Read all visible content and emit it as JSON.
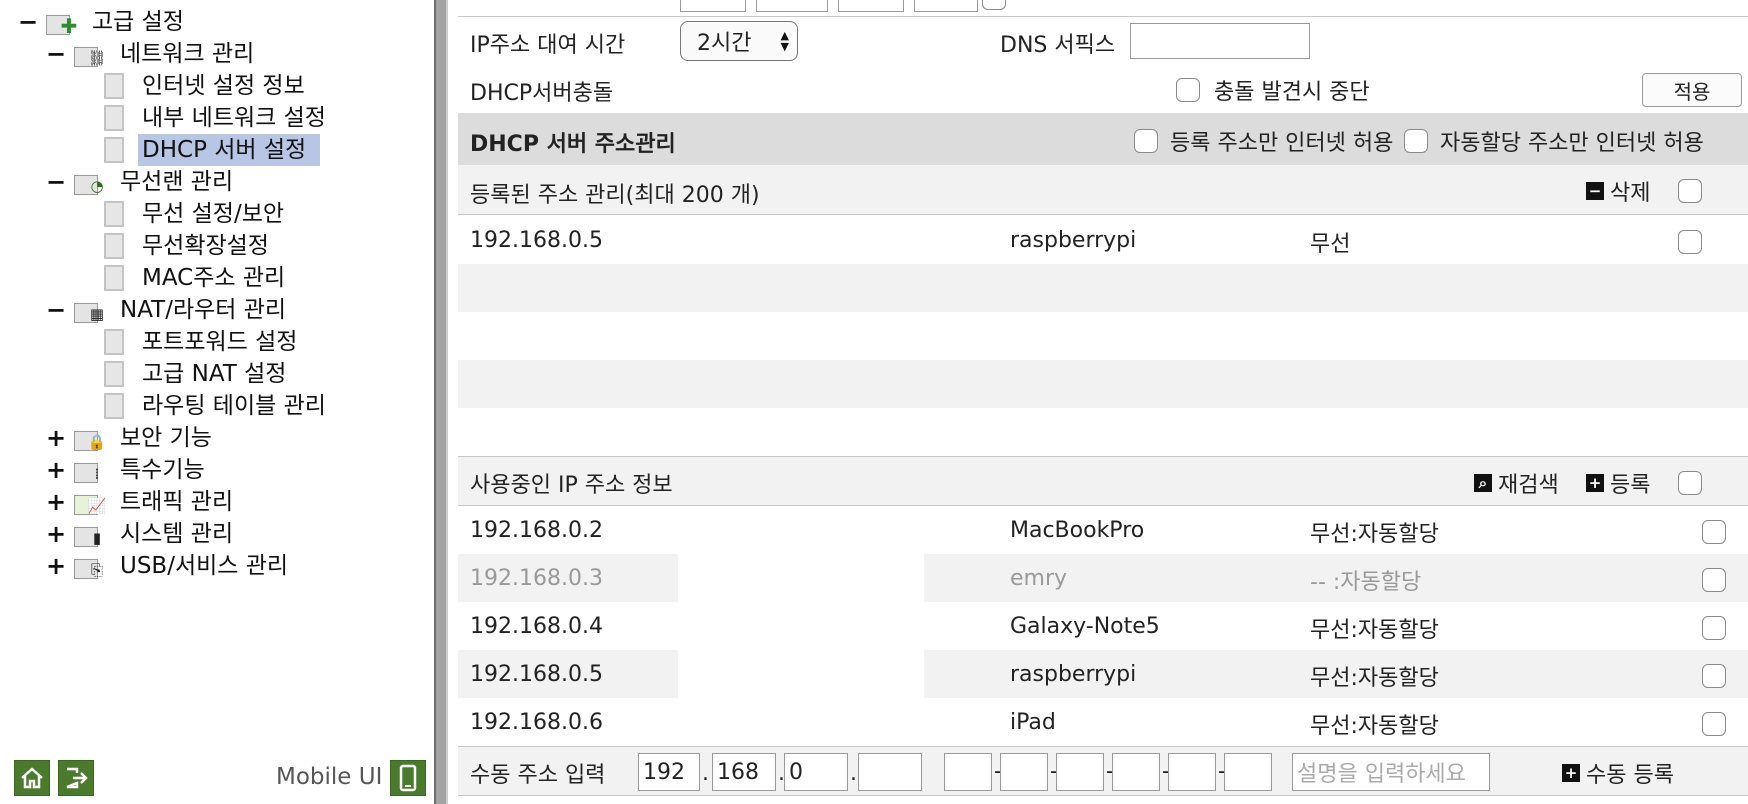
{
  "tree": {
    "root": {
      "label": "고급 설정",
      "toggle": "−"
    },
    "network": {
      "label": "네트워크 관리",
      "toggle": "−",
      "children": [
        "인터넷 설정 정보",
        "내부 네트워크 설정",
        "DHCP 서버 설정"
      ]
    },
    "wireless": {
      "label": "무선랜 관리",
      "toggle": "−",
      "children": [
        "무선 설정/보안",
        "무선확장설정",
        "MAC주소 관리"
      ]
    },
    "nat": {
      "label": "NAT/라우터 관리",
      "toggle": "−",
      "children": [
        "포트포워드 설정",
        "고급 NAT 설정",
        "라우팅 테이블 관리"
      ]
    },
    "security": {
      "label": "보안 기능",
      "toggle": "+"
    },
    "special": {
      "label": "특수기능",
      "toggle": "+"
    },
    "traffic": {
      "label": "트래픽 관리",
      "toggle": "+"
    },
    "system": {
      "label": "시스템 관리",
      "toggle": "+"
    },
    "usb": {
      "label": "USB/서비스 관리",
      "toggle": "+"
    }
  },
  "footer": {
    "mobile_label": "Mobile UI"
  },
  "dhcp": {
    "lease_label": "IP주소 대여 시간",
    "lease_value": "2시간",
    "dns_label": "DNS 서픽스",
    "dns_value": "",
    "conflict_label": "DHCP서버충돌",
    "conflict_stop_label": "충돌 발견시 중단",
    "apply_label": "적용",
    "addr_mgmt_title": "DHCP 서버 주소관리",
    "reg_only_label": "등록 주소만 인터넷 허용",
    "auto_only_label": "자동할당 주소만 인터넷 허용"
  },
  "registered": {
    "title": "등록된 주소 관리(최대 200 개)",
    "delete_label": "삭제",
    "rows": [
      {
        "ip": "192.168.0.5",
        "name": "raspberrypi",
        "type": "무선"
      }
    ]
  },
  "in_use": {
    "title": "사용중인 IP 주소 정보",
    "rescan_label": "재검색",
    "register_label": "등록",
    "rows": [
      {
        "ip": "192.168.0.2",
        "name": "MacBookPro",
        "type": "무선:자동할당",
        "dim": false
      },
      {
        "ip": "192.168.0.3",
        "name": "emry",
        "type": "-- :자동할당",
        "dim": true
      },
      {
        "ip": "192.168.0.4",
        "name": "Galaxy-Note5",
        "type": "무선:자동할당",
        "dim": false
      },
      {
        "ip": "192.168.0.5",
        "name": "raspberrypi",
        "type": "무선:자동할당",
        "dim": false
      },
      {
        "ip": "192.168.0.6",
        "name": "iPad",
        "type": "무선:자동할당",
        "dim": false
      }
    ]
  },
  "manual": {
    "label": "수동 주소 입력",
    "ip1": "192",
    "ip2": "168",
    "ip3": "0",
    "ip4": "",
    "mac_sep": "-",
    "desc_placeholder": "설명을 입력하세요",
    "submit_label": "수동 등록"
  },
  "colors": {
    "selected": "#b6c6e4",
    "header_bg": "#dcdcdc",
    "row_alt": "#f2f2f2",
    "green_icon": "#4a7a2c"
  }
}
